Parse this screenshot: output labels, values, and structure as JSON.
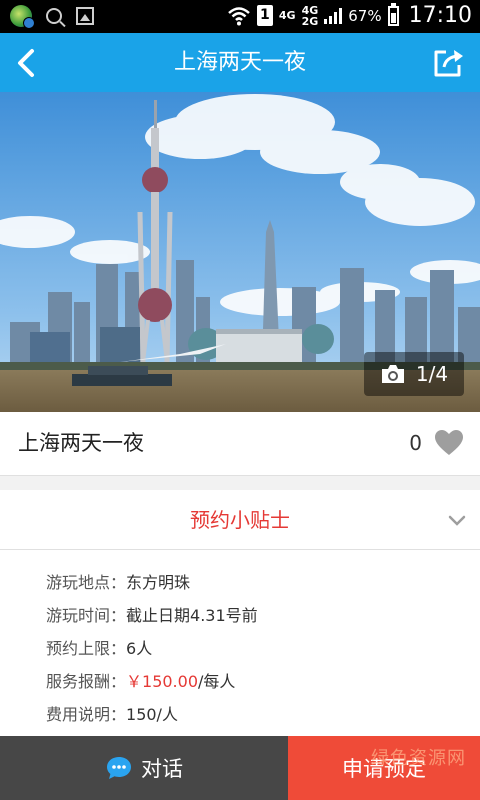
{
  "status_bar": {
    "net_top": "4G",
    "net_mid": "4G",
    "net_bottom": "2G",
    "battery": "67%",
    "time": "17:10",
    "sim": "1"
  },
  "header": {
    "title": "上海两天一夜",
    "back_icon": "chevron-left-icon",
    "share_icon": "share-icon"
  },
  "gallery": {
    "counter": "1/4",
    "camera_icon": "camera-icon"
  },
  "trip": {
    "name": "上海两天一夜",
    "likes": "0",
    "like_icon": "heart-icon"
  },
  "tips": {
    "title": "预约小贴士",
    "toggle_icon": "chevron-down-icon"
  },
  "details": [
    {
      "label": "游玩地点：",
      "value": "东方明珠"
    },
    {
      "label": "游玩时间：",
      "value": "截止日期4.31号前"
    },
    {
      "label": "预约上限：",
      "value": "6人"
    },
    {
      "label": "服务报酬：",
      "price": "￥150.00",
      "value": "/每人"
    },
    {
      "label": "费用说明：",
      "value": "150/人"
    }
  ],
  "bottom": {
    "chat_label": "对话",
    "book_label": "申请预定",
    "watermark": "绿色资源网"
  },
  "colors": {
    "header": "#1aa3e8",
    "accent": "#e53935",
    "book_button": "#ef4b38",
    "chat_button": "#474747"
  }
}
